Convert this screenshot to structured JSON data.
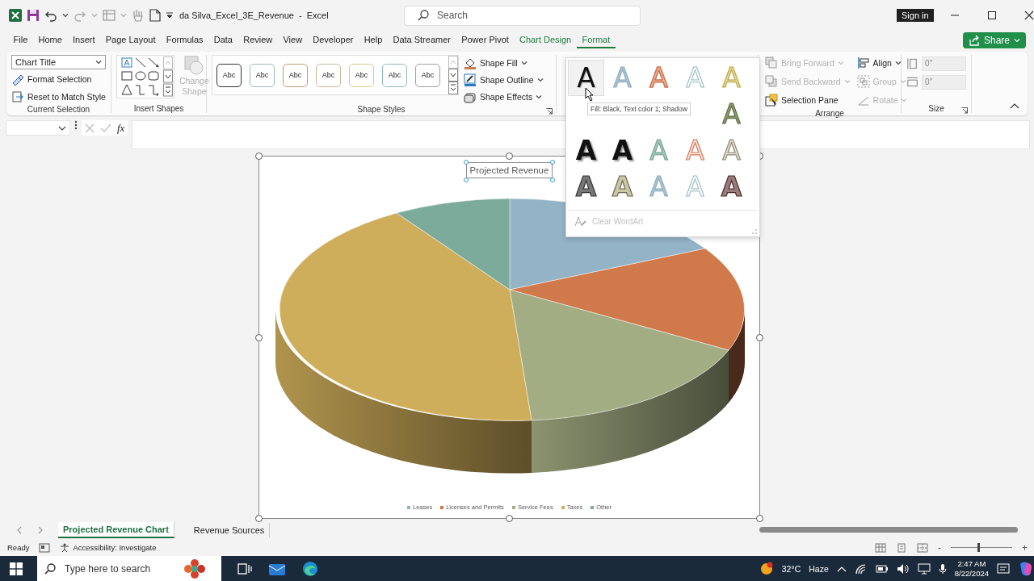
{
  "title_bar": {
    "title": "da Silva_Excel_3E_Revenue  -  Excel",
    "search_placeholder": "Search",
    "sign_in": "Sign in"
  },
  "menu_tabs": [
    {
      "label": "File",
      "kind": "plain",
      "selected": false
    },
    {
      "label": "Home",
      "kind": "plain",
      "selected": false
    },
    {
      "label": "Insert",
      "kind": "plain",
      "selected": false
    },
    {
      "label": "Page Layout",
      "kind": "plain",
      "selected": false
    },
    {
      "label": "Formulas",
      "kind": "plain",
      "selected": false
    },
    {
      "label": "Data",
      "kind": "plain",
      "selected": false
    },
    {
      "label": "Review",
      "kind": "plain",
      "selected": false
    },
    {
      "label": "View",
      "kind": "plain",
      "selected": false
    },
    {
      "label": "Developer",
      "kind": "plain",
      "selected": false
    },
    {
      "label": "Help",
      "kind": "plain",
      "selected": false
    },
    {
      "label": "Data Streamer",
      "kind": "plain",
      "selected": false
    },
    {
      "label": "Power Pivot",
      "kind": "plain",
      "selected": false
    },
    {
      "label": "Chart Design",
      "kind": "contextual",
      "selected": false
    },
    {
      "label": "Format",
      "kind": "contextual",
      "selected": true
    }
  ],
  "share_button": "Share",
  "ribbon": {
    "current_selection": {
      "element": "Chart Title",
      "commands": [
        "Format Selection",
        "Reset to Match Style"
      ],
      "label": "Current Selection"
    },
    "insert_shapes": {
      "change_shape": {
        "label": "Change Shape",
        "disabled": true
      },
      "label": "Insert Shapes"
    },
    "shape_styles": {
      "swatches": [
        {
          "text": "Abc",
          "color": "#333333"
        },
        {
          "text": "Abc",
          "color": "#9fb4c0"
        },
        {
          "text": "Abc",
          "color": "#c39a6e"
        },
        {
          "text": "Abc",
          "color": "#c9b99a"
        },
        {
          "text": "Abc",
          "color": "#d8c98e"
        },
        {
          "text": "Abc",
          "color": "#8fb8b8"
        },
        {
          "text": "Abc",
          "color": "#a0a0a0"
        }
      ],
      "commands": [
        "Shape Fill",
        "Shape Outline",
        "Shape Effects"
      ],
      "label": "Shape Styles"
    },
    "arrange": {
      "commands": [
        {
          "label": "Bring Forward",
          "disabled": true
        },
        {
          "label": "Send Backward",
          "disabled": true
        },
        {
          "label": "Selection Pane",
          "disabled": false
        },
        {
          "label": "Align",
          "disabled": false
        },
        {
          "label": "Group",
          "disabled": true
        },
        {
          "label": "Rotate",
          "disabled": true
        }
      ],
      "label": "Arrange"
    },
    "size": {
      "height": "0\"",
      "width": "0\"",
      "label": "Size"
    }
  },
  "wordart_gallery": {
    "rows": [
      [
        {
          "text": "A",
          "kind": "black",
          "selected": true
        },
        {
          "text": "A",
          "kind": "blue",
          "selected": false
        },
        {
          "text": "A",
          "kind": "orange",
          "selected": false
        },
        {
          "text": "A",
          "kind": "outline",
          "selected": false
        },
        {
          "text": "A",
          "kind": "gold",
          "selected": false
        }
      ],
      [
        "",
        "",
        "",
        "",
        {
          "text": "A",
          "kind": "olive",
          "selected": false
        }
      ],
      [
        {
          "text": "A",
          "kind": "heavy",
          "selected": false
        },
        {
          "text": "A",
          "kind": "heavy",
          "selected": false
        },
        {
          "text": "A",
          "kind": "teal",
          "selected": false
        },
        {
          "text": "A",
          "kind": "orangelight",
          "selected": false
        },
        {
          "text": "A",
          "kind": "beige",
          "selected": false
        }
      ],
      [
        {
          "text": "A",
          "kind": "darkgrey",
          "selected": false
        },
        {
          "text": "A",
          "kind": "khaki",
          "selected": false
        },
        {
          "text": "A",
          "kind": "blue",
          "selected": false
        },
        {
          "text": "A",
          "kind": "outline",
          "selected": false
        },
        {
          "text": "A",
          "kind": "maroon",
          "selected": false
        }
      ]
    ],
    "tooltip": "Fill: Black, Text color 1; Shadow",
    "clear": {
      "label": "Clear WordArt",
      "disabled": true
    }
  },
  "formula_bar": {
    "function_label": "fx"
  },
  "chart": {
    "title": "Projected Revenue",
    "title_selected": true,
    "legend": [
      {
        "label": "Leases",
        "color": "#93b3c7"
      },
      {
        "label": "Licenses and Permits",
        "color": "#d0794a"
      },
      {
        "label": "Service Fees",
        "color": "#a3ad83"
      },
      {
        "label": "Taxes",
        "color": "#cfae5b"
      },
      {
        "label": "Other",
        "color": "#7caa9b"
      }
    ]
  },
  "sheet_tabs": [
    {
      "label": "Projected Revenue Chart",
      "selected": true
    },
    {
      "label": "Revenue Sources",
      "selected": false
    }
  ],
  "status_bar": {
    "status": "Ready",
    "accessibility": "Accessibility: Investigate",
    "zoom_out": "-",
    "zoom_in": "+",
    "zoom": {
      "level": 0.45
    }
  },
  "taskbar": {
    "search_placeholder": "Type here to search",
    "temperature": "32°C",
    "condition": "Haze",
    "time": "2:47 AM",
    "date": "8/22/2024"
  }
}
